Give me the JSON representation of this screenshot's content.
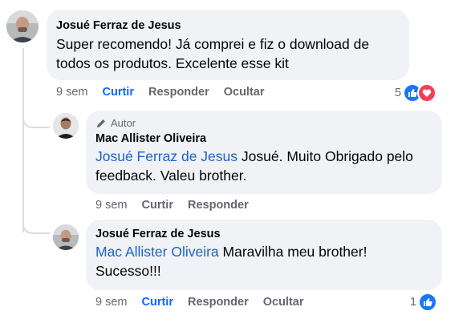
{
  "comment1": {
    "author": "Josué Ferraz de Jesus",
    "text_line1": "Super recomendo! Já comprei e fiz o download de",
    "text_line2": "todos os produtos. Excelente esse kit",
    "time": "9 sem",
    "like_label": "Curtir",
    "reply_label": "Responder",
    "hide_label": "Ocultar",
    "reaction_count": "5"
  },
  "reply1": {
    "author_tag": "Autor",
    "author": "Mac Allister Oliveira",
    "mention": "Josué Ferraz de Jesus",
    "text_line1": " Josué. Muito Obrigado pelo",
    "text_line2": "feedback. Valeu brother.",
    "time": "9 sem",
    "like_label": "Curtir",
    "reply_label": "Responder"
  },
  "reply2": {
    "author": "Josué Ferraz de Jesus",
    "mention": "Mac Allister Oliveira",
    "text_line1": " Maravilha meu brother!",
    "text_line2": "Sucesso!!!",
    "time": "9 sem",
    "like_label": "Curtir",
    "reply_label": "Responder",
    "hide_label": "Ocultar",
    "reaction_count": "1"
  },
  "colors": {
    "bubble": "#f0f2f5",
    "mention": "#1b63c9",
    "like_active": "#0866ff",
    "meta_gray": "#65676b",
    "like_icon": "#1877f2",
    "love_icon": "#f33e58"
  }
}
